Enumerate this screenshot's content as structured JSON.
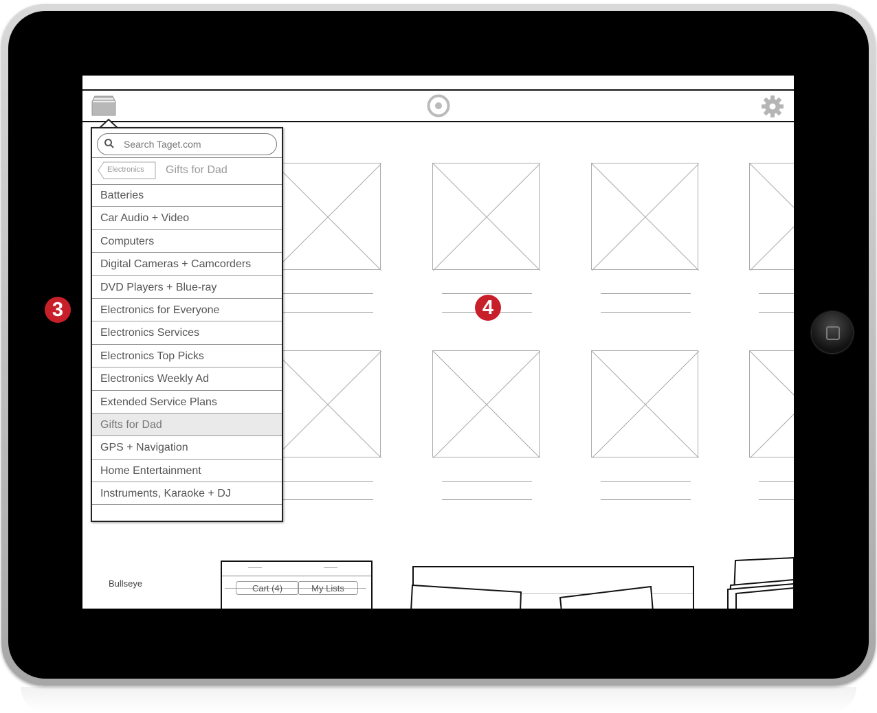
{
  "annotations": {
    "left_marker": "3",
    "center_marker": "4"
  },
  "colors": {
    "marker": "#c8202a",
    "bezel": "#000000",
    "selected_row": "#eaeaea"
  },
  "header": {
    "left_icon": "category-drawer-icon",
    "center_icon": "target-logo-icon",
    "right_icon": "gear-icon"
  },
  "dropdown": {
    "search": {
      "placeholder": "Search Taget.com",
      "value": ""
    },
    "breadcrumb": {
      "back_label": "Electronics",
      "title": "Gifts for Dad"
    },
    "items": [
      "Batteries",
      "Car Audio + Video",
      "Computers",
      "Digital Cameras + Camcorders",
      "DVD Players + Blue-ray",
      "Electronics for Everyone",
      "Electronics Services",
      "Electronics Top Picks",
      "Electronics Weekly Ad",
      "Extended Service Plans",
      "Gifts for Dad",
      "GPS + Navigation",
      "Home Entertainment",
      "Instruments, Karaoke + DJ"
    ],
    "selected_item": "Gifts for Dad"
  },
  "footer": {
    "bullseye_label": "Bullseye",
    "cart_label": "Cart (4)",
    "lists_label": "My Lists"
  }
}
